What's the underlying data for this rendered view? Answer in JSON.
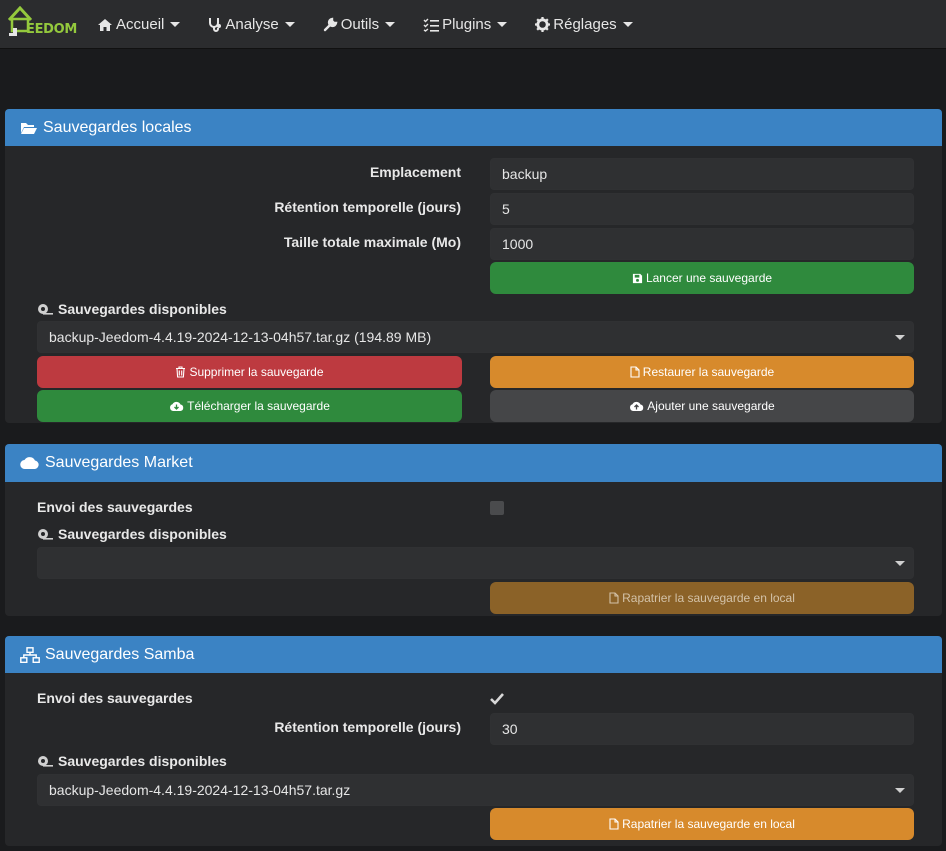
{
  "navbar": {
    "logo_text": "EEDOM",
    "items": [
      {
        "label": "Accueil"
      },
      {
        "label": "Analyse"
      },
      {
        "label": "Outils"
      },
      {
        "label": "Plugins"
      },
      {
        "label": "Réglages"
      }
    ]
  },
  "local": {
    "title": "Sauvegardes locales",
    "location_label": "Emplacement",
    "location_value": "backup",
    "retention_label": "Rétention temporelle (jours)",
    "retention_value": "5",
    "max_size_label": "Taille totale maximale (Mo)",
    "max_size_value": "1000",
    "launch_button": "Lancer une sauvegarde",
    "available_label": "Sauvegardes disponibles",
    "selected_backup": "backup-Jeedom-4.4.19-2024-12-13-04h57.tar.gz (194.89 MB)",
    "delete_button": "Supprimer la sauvegarde",
    "restore_button": "Restaurer la sauvegarde",
    "download_button": "Télécharger la sauvegarde",
    "add_button": "Ajouter une sauvegarde"
  },
  "market": {
    "title": "Sauvegardes Market",
    "send_label": "Envoi des sauvegardes",
    "send_checked": false,
    "available_label": "Sauvegardes disponibles",
    "selected_backup": "",
    "fetch_button": "Rapatrier la sauvegarde en local"
  },
  "samba": {
    "title": "Sauvegardes Samba",
    "send_label": "Envoi des sauvegardes",
    "send_checked": true,
    "retention_label": "Rétention temporelle (jours)",
    "retention_value": "30",
    "available_label": "Sauvegardes disponibles",
    "selected_backup": "backup-Jeedom-4.4.19-2024-12-13-04h57.tar.gz",
    "fetch_button": "Rapatrier la sauvegarde en local"
  },
  "colors": {
    "panel_heading": "#3b83c4",
    "green": "#2f8a3d",
    "red": "#bd3a40",
    "orange": "#d78a2c",
    "logo_green": "#94c93d"
  }
}
